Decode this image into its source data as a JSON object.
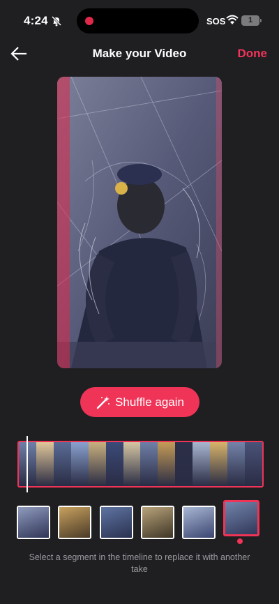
{
  "status_bar": {
    "time": "4:24",
    "carrier_text": "SOS",
    "battery_level": "1"
  },
  "header": {
    "title": "Make your Video",
    "done_label": "Done"
  },
  "video_preview": {
    "description_icon": "video-frame"
  },
  "shuffle_button": {
    "label": "Shuffle again",
    "icon": "magic-wand-icon"
  },
  "timeline": {
    "segments": [
      "#6e7fa8",
      "#e1c79a",
      "#5a6c96",
      "#8aa1cf",
      "#c9b07e",
      "#3b4a78",
      "#d6c6a3",
      "#6f7fa7",
      "#c59b57",
      "#2c2f49",
      "#a9b6d0",
      "#d8b46a",
      "#7483a9",
      "#4a5278"
    ],
    "playhead_position": 0.04
  },
  "takes": {
    "items": [
      {
        "colors": [
          "#8f9bbd",
          "#2f3557"
        ]
      },
      {
        "colors": [
          "#c8a15e",
          "#4a3a28"
        ]
      },
      {
        "colors": [
          "#5f74a2",
          "#2a3150"
        ]
      },
      {
        "colors": [
          "#b8a37a",
          "#3e3526"
        ]
      },
      {
        "colors": [
          "#a8b7d4",
          "#3b4570"
        ]
      },
      {
        "colors": [
          "#7383aa",
          "#30385a"
        ]
      }
    ],
    "selected_index": 5
  },
  "hint": "Select a segment in the timeline to replace it with another take",
  "colors": {
    "accent": "#ef3457",
    "background": "#1f1e21"
  }
}
